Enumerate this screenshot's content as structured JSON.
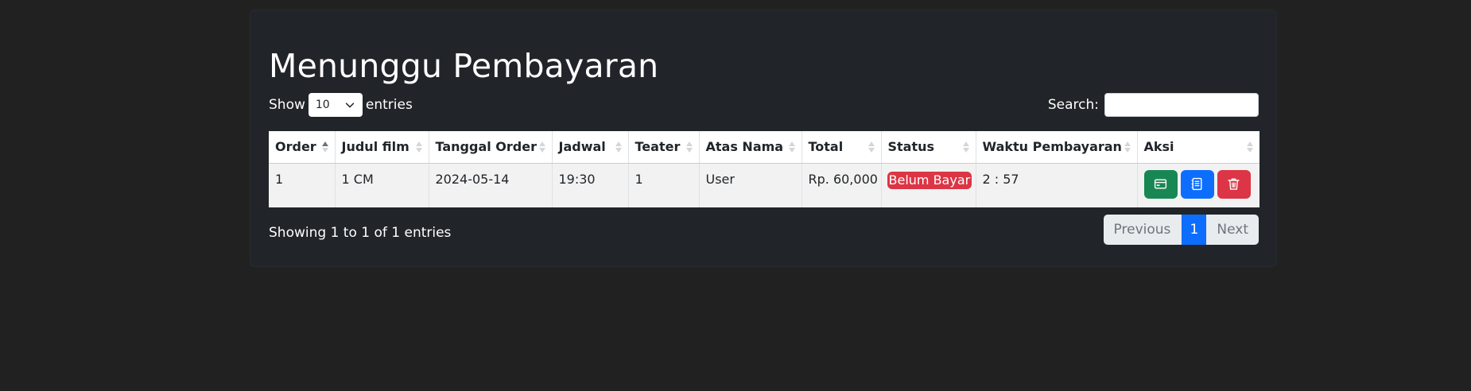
{
  "page": {
    "title": "Menunggu Pembayaran"
  },
  "length_control": {
    "prefix": "Show",
    "selected": "10",
    "suffix": "entries"
  },
  "search": {
    "label": "Search:",
    "value": ""
  },
  "table": {
    "columns": [
      "Order",
      "Judul film",
      "Tanggal Order",
      "Jadwal",
      "Teater",
      "Atas Nama",
      "Total",
      "Status",
      "Waktu Pembayaran",
      "Aksi"
    ],
    "sorted_column": "Order",
    "sort_direction": "ascending",
    "rows": [
      {
        "order": "1",
        "judul_film": "1 CM",
        "tanggal_order": "2024-05-14",
        "jadwal": "19:30",
        "teater": "1",
        "atas_nama": "User",
        "total": "Rp. 60,000",
        "status": "Belum Bayar",
        "waktu_pembayaran": "2 : 57",
        "actions": [
          {
            "icon": "credit-card-icon",
            "color": "#198754"
          },
          {
            "icon": "receipt-icon",
            "color": "#0d6efd"
          },
          {
            "icon": "trash-icon",
            "color": "#dc3545"
          }
        ]
      }
    ]
  },
  "footer": {
    "info": "Showing 1 to 1 of 1 entries"
  },
  "pagination": {
    "previous": "Previous",
    "current": "1",
    "next": "Next"
  },
  "colors": {
    "page_bg": "#212121",
    "card_bg": "#212529",
    "status_badge": "#dc3545",
    "active_page": "#0d6efd"
  }
}
